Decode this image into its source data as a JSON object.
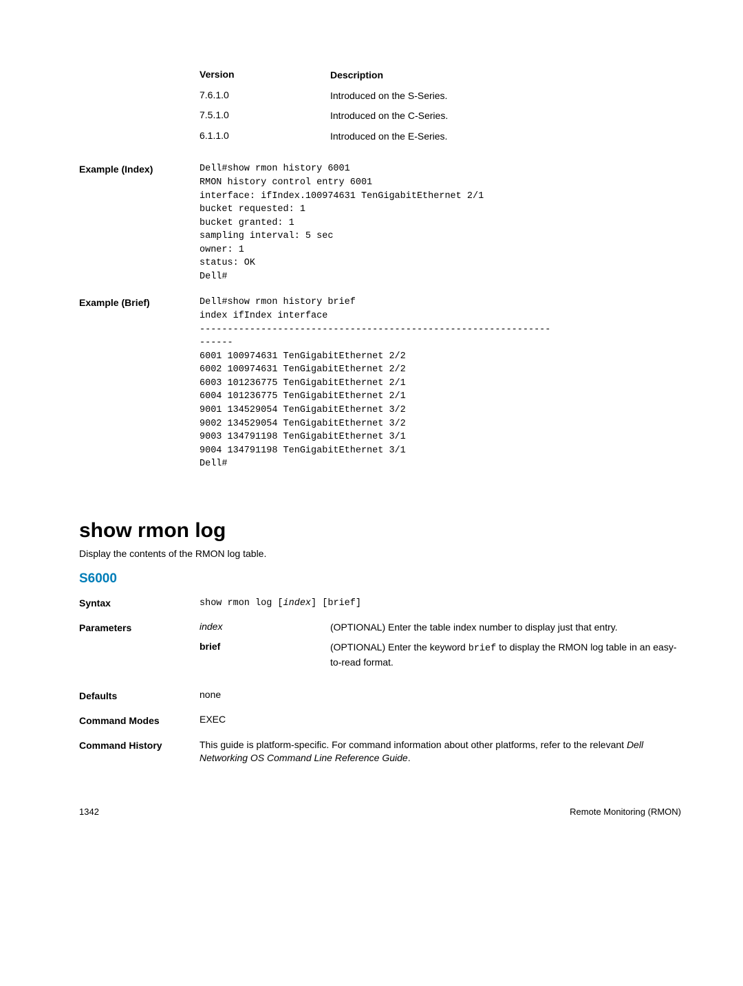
{
  "versionTable": {
    "header": {
      "col1": "Version",
      "col2": "Description"
    },
    "rows": [
      {
        "version": "7.6.1.0",
        "desc": "Introduced on the S-Series."
      },
      {
        "version": "7.5.1.0",
        "desc": "Introduced on the C-Series."
      },
      {
        "version": "6.1.1.0",
        "desc": "Introduced on the E-Series."
      }
    ]
  },
  "exampleIndex": {
    "label": "Example (Index)",
    "code": "Dell#show rmon history 6001\nRMON history control entry 6001\ninterface: ifIndex.100974631 TenGigabitEthernet 2/1\nbucket requested: 1\nbucket granted: 1\nsampling interval: 5 sec\nowner: 1\nstatus: OK\nDell#"
  },
  "exampleBrief": {
    "label": "Example (Brief)",
    "code": "Dell#show rmon history brief\nindex ifIndex interface\n---------------------------------------------------------------\n------\n6001 100974631 TenGigabitEthernet 2/2\n6002 100974631 TenGigabitEthernet 2/2\n6003 101236775 TenGigabitEthernet 2/1\n6004 101236775 TenGigabitEthernet 2/1\n9001 134529054 TenGigabitEthernet 3/2\n9002 134529054 TenGigabitEthernet 3/2\n9003 134791198 TenGigabitEthernet 3/1\n9004 134791198 TenGigabitEthernet 3/1\nDell#"
  },
  "section": {
    "title": "show rmon log",
    "desc": "Display the contents of the RMON log table.",
    "subhead": "S6000"
  },
  "syntax": {
    "label": "Syntax",
    "code_pre": "show rmon log [",
    "code_index": "index",
    "code_post": "] [brief]"
  },
  "parameters": {
    "label": "Parameters",
    "rows": [
      {
        "name": "index",
        "italic": true,
        "desc": "(OPTIONAL) Enter the table index number to display just that entry."
      },
      {
        "name": "brief",
        "italic": false,
        "desc_pre": "(OPTIONAL) Enter the keyword ",
        "desc_code": "brief",
        "desc_post": " to display the RMON log table in an easy-to-read format."
      }
    ]
  },
  "defaults": {
    "label": "Defaults",
    "value": "none"
  },
  "commandModes": {
    "label": "Command Modes",
    "value": "EXEC"
  },
  "commandHistory": {
    "label": "Command History",
    "text_pre": "This guide is platform-specific. For command information about other platforms, refer to the relevant ",
    "text_italic": "Dell Networking OS Command Line Reference Guide",
    "text_post": "."
  },
  "footer": {
    "page": "1342",
    "section": "Remote Monitoring (RMON)"
  }
}
